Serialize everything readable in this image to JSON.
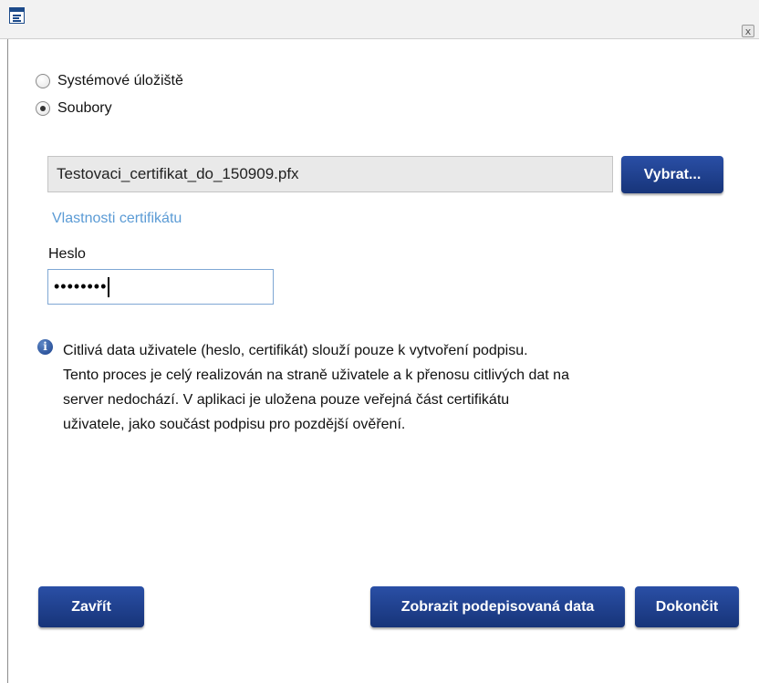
{
  "window": {
    "close_label": "x"
  },
  "storage": {
    "options": [
      {
        "label": "Systémové úložiště",
        "checked": false
      },
      {
        "label": "Soubory",
        "checked": true
      }
    ]
  },
  "file": {
    "value": "Testovaci_certifikat_do_150909.pfx",
    "browse_label": "Vybrat..."
  },
  "cert_properties_link": "Vlastnosti certifikátu",
  "password": {
    "label": "Heslo",
    "value_masked": "••••••••"
  },
  "info": {
    "lines": [
      "Citlivá data uživatele (heslo, certifikát) slouží pouze k vytvoření podpisu.",
      "Tento proces je celý realizován na straně uživatele a k přenosu citlivých dat na",
      "server nedochází. V aplikaci je uložena pouze veřejná část certifikátu",
      "uživatele, jako součást podpisu pro pozdější ověření."
    ]
  },
  "footer": {
    "close_label": "Zavřít",
    "show_data_label": "Zobrazit podepisovaná data",
    "finish_label": "Dokončit"
  },
  "colors": {
    "button": "#1d3d8f",
    "link": "#5b9bd5",
    "titlebar": "#f2f2f2"
  }
}
